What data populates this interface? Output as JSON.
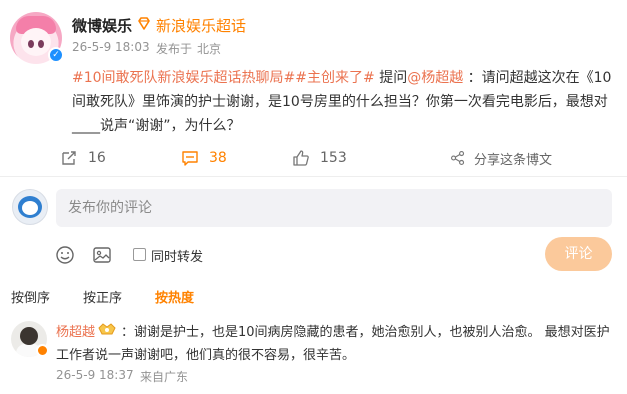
{
  "post": {
    "author": "微博娱乐",
    "super_topic": "新浪娱乐超话",
    "time": "26-5-9 18:03",
    "source": "发布于",
    "location": "北京",
    "hashtag1": "#10间敢死队新浪娱乐超话热聊局#",
    "hashtag2": "#主创来了#",
    "ask_prefix": " 提问",
    "mention": "@杨超越",
    "question": " ：请问超越这次在《10间敢死队》里饰演的护士谢谢，是10号房里的什么担当？你第一次看完电影后，最想对____说声“谢谢”，为什么？"
  },
  "actions": {
    "repost_count": "16",
    "comment_count": "38",
    "like_count": "153",
    "share_label": "分享这条博文"
  },
  "composer": {
    "placeholder": "发布你的评论",
    "repost_label": "同时转发",
    "submit_label": "评论"
  },
  "sort": {
    "by_time_desc": "按倒序",
    "by_time_asc": "按正序",
    "by_hot": "按热度"
  },
  "comment": {
    "author": "杨超越",
    "text": "：谢谢是护士，也是10间病房隐藏的患者，她治愈别人，也被别人治愈。 最想对医护工作者说一声谢谢吧，他们真的很不容易，很辛苦。",
    "time": "26-5-9 18:37",
    "from": "来自广东"
  },
  "colors": {
    "accent": "#ff8200",
    "link": "#eb7350",
    "submit_disabled": "#fbc99b"
  }
}
